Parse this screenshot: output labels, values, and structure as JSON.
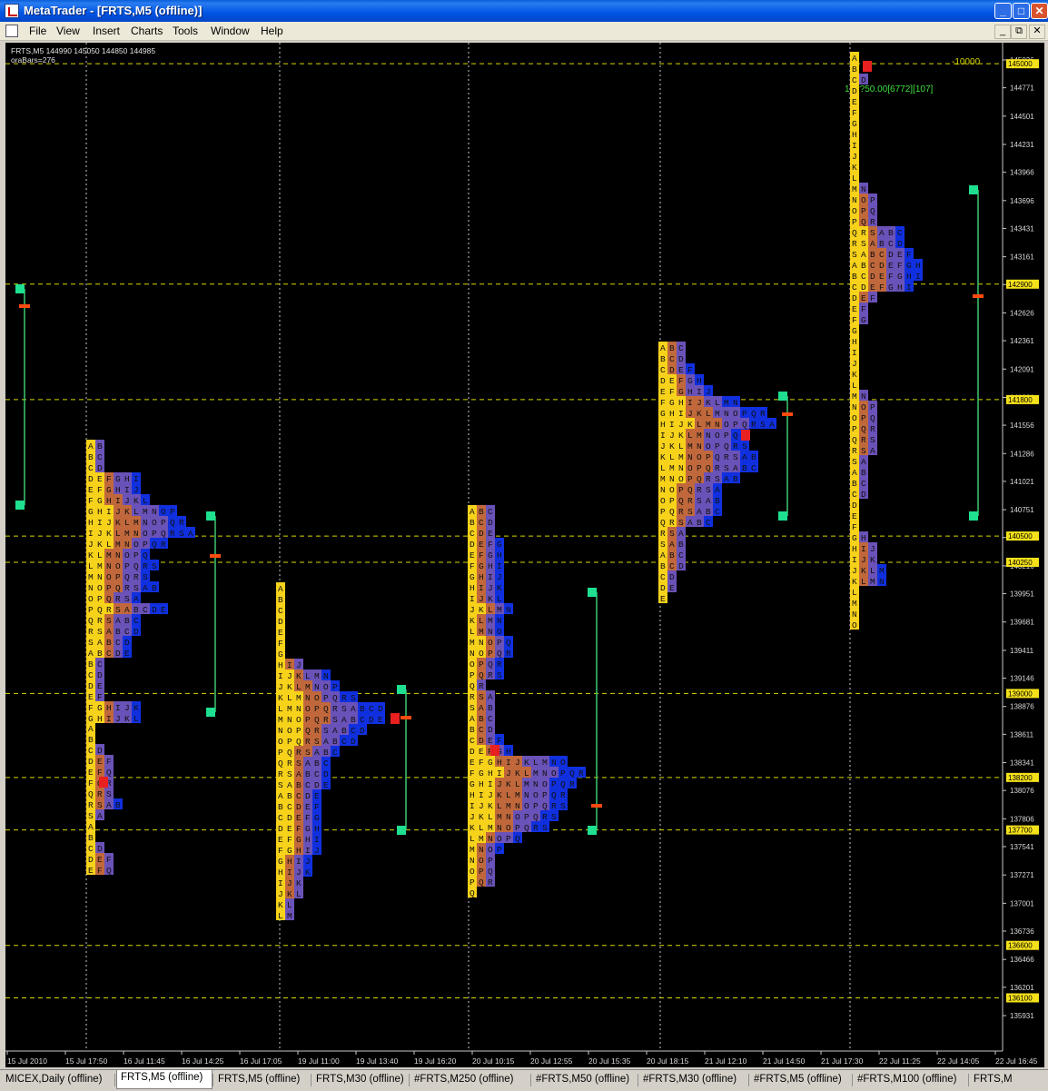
{
  "window": {
    "title": "MetaTrader - [FRTS,M5 (offline)]",
    "buttons": {
      "minimize": "_",
      "maximize": "□",
      "close": "✕"
    },
    "mdi_buttons": {
      "minimize": "_",
      "restore": "⧉",
      "close": "✕"
    }
  },
  "menu": {
    "items": [
      "File",
      "View",
      "Insert",
      "Charts",
      "Tools",
      "Window",
      "Help"
    ]
  },
  "chart": {
    "info_line": "FRTS,M5  144990 145050 144850 144985",
    "info_sub": "oraBars=276",
    "volume_label": "-10000",
    "ib_label": "13??50.00[6772][107]",
    "colors": {
      "background": "#000000",
      "grid": "#c8c8c8",
      "level_line": "#d8d800",
      "level_box": "#f5e11a",
      "range_line": "#3cc870",
      "range_box": "#1ee090",
      "poc": "#ff4a10",
      "tpo_a": "#f7d21a",
      "tpo_b": "#c0683c",
      "tpo_c": "#6a52b8",
      "tpo_d": "#1030e0",
      "tpo_last": "#a8d0e8",
      "tpo_open": "#e82020"
    }
  },
  "price_axis": {
    "ticks": [
      "145036",
      "144771",
      "144501",
      "144231",
      "143966",
      "143696",
      "143431",
      "143161",
      "142896",
      "142626",
      "142361",
      "142091",
      "141821",
      "141556",
      "141286",
      "141021",
      "140751",
      "140486",
      "140216",
      "139951",
      "139681",
      "139411",
      "139146",
      "138876",
      "138611",
      "138341",
      "138076",
      "137806",
      "137541",
      "137271",
      "137001",
      "136736",
      "136466",
      "136201",
      "135931"
    ],
    "levels": [
      "145000",
      "142900",
      "141800",
      "140500",
      "140250",
      "139000",
      "138200",
      "137700",
      "136600",
      "136100"
    ]
  },
  "time_axis": {
    "labels": [
      "15 Jul 2010",
      "15 Jul 17:50",
      "16 Jul 11:45",
      "16 Jul 14:25",
      "16 Jul 17:05",
      "19 Jul 11:00",
      "19 Jul 13:40",
      "19 Jul 16:20",
      "20 Jul 10:15",
      "20 Jul 12:55",
      "20 Jul 15:35",
      "20 Jul 18:15",
      "21 Jul 12:10",
      "21 Jul 14:50",
      "21 Jul 17:30",
      "22 Jul 11:25",
      "22 Jul 14:05",
      "22 Jul 16:45"
    ]
  },
  "tabs": [
    {
      "label": "MICEX,Daily (offline)",
      "active": false
    },
    {
      "label": "FRTS,M5 (offline)",
      "active": true
    },
    {
      "label": "FRTS,M5 (offline)",
      "active": false
    },
    {
      "label": "FRTS,M30 (offline)",
      "active": false
    },
    {
      "label": "#FRTS,M250 (offline)",
      "active": false
    },
    {
      "label": "#FRTS,M50 (offline)",
      "active": false
    },
    {
      "label": "#FRTS,M30 (offline)",
      "active": false
    },
    {
      "label": "#FRTS,M5 (offline)",
      "active": false
    },
    {
      "label": "#FRTS,M100 (offline)",
      "active": false
    },
    {
      "label": "FRTS,M",
      "active": false
    }
  ]
}
